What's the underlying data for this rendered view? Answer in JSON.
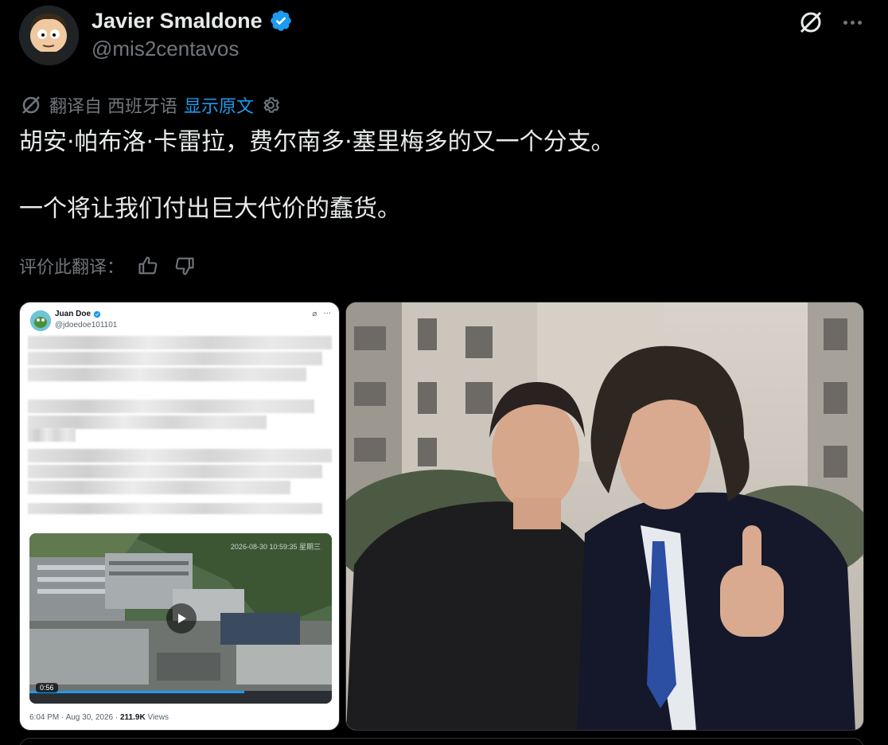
{
  "author": {
    "name": "Javier Smaldone",
    "handle": "@mis2centavos"
  },
  "translation": {
    "translated_from": "翻译自 西班牙语",
    "show_original": "显示原文"
  },
  "tweet": {
    "paragraphs": [
      "胡安·帕布洛·卡雷拉，费尔南多·塞里梅多的又一个分支。",
      "一个将让我们付出巨大代价的蠢货。"
    ]
  },
  "rate_translation": {
    "label": "评价此翻译："
  },
  "embedded_post": {
    "name": "Juan Doe",
    "handle": "@jdoedoe101101",
    "video_duration": "0:56",
    "video_timestamp": "2026-08-30 10:59:35 星期三",
    "time": "6:04 PM · Aug 30, 2026 · ",
    "views_count": "211.9K",
    "views_label": " Views"
  },
  "colors": {
    "background": "#000000",
    "text": "#e7e9ea",
    "muted": "#71767b",
    "link": "#1d9bf0",
    "verified": "#1d9bf0"
  },
  "icons": [
    "grok-icon",
    "more-icon",
    "verified-badge-icon",
    "translate-icon",
    "settings-icon",
    "thumbs-up-icon",
    "thumbs-down-icon",
    "play-icon"
  ]
}
